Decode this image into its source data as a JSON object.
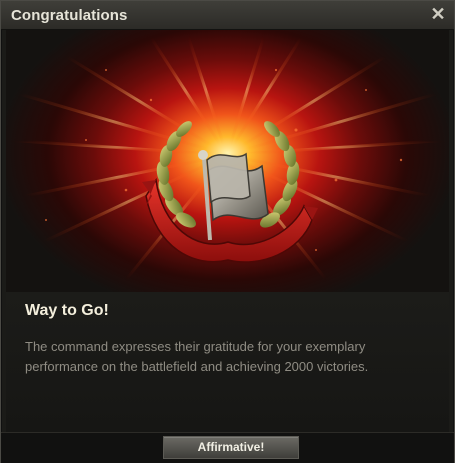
{
  "dialog": {
    "title": "Congratulations",
    "close_icon": "close-icon"
  },
  "achievement": {
    "emblem": "flag-laurel-ribbon-icon",
    "heading": "Way to Go!",
    "message": "The command expresses their gratitude for your exemplary performance on the battlefield and achieving 2000 victories."
  },
  "footer": {
    "confirm_label": "Affirmative!"
  },
  "colors": {
    "title_text": "#e6e4d8",
    "heading_text": "#f4efdc",
    "message_text": "#8f8c83",
    "glow_core": "#ffb92c",
    "glow_red": "#b81410",
    "ribbon": "#c0201b"
  }
}
